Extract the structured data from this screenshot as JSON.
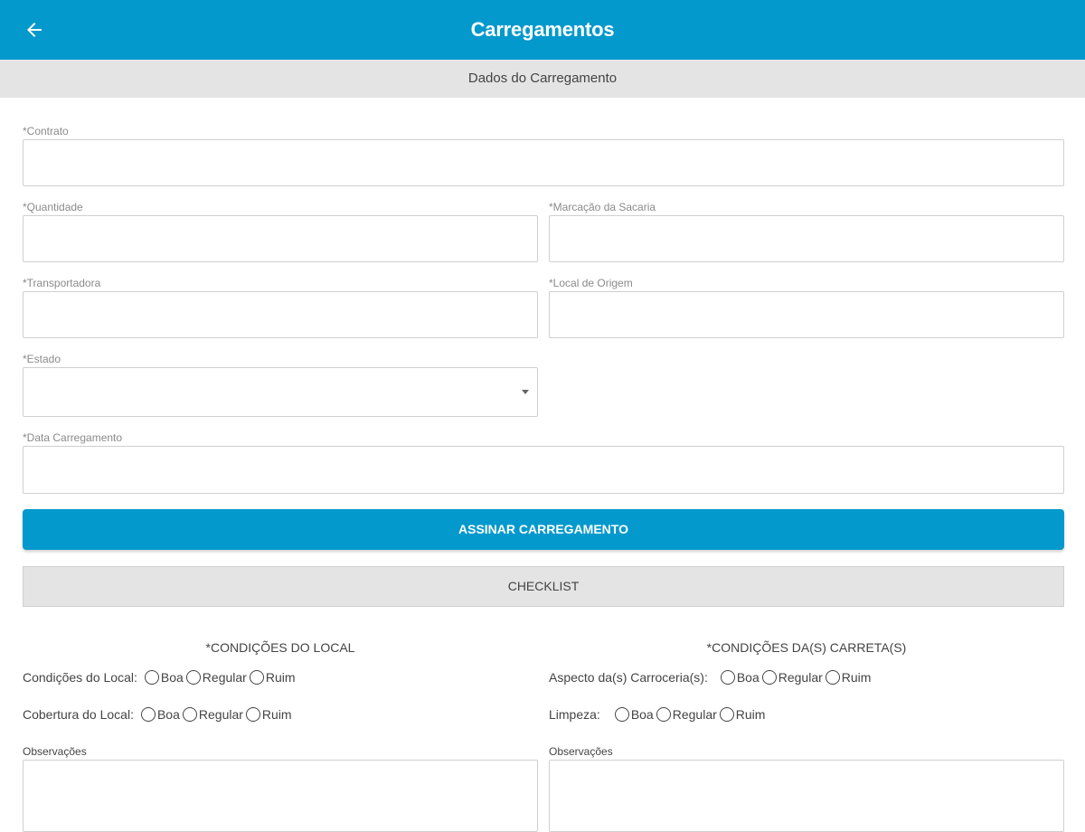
{
  "header": {
    "title": "Carregamentos",
    "section": "Dados do Carregamento"
  },
  "form": {
    "contrato_label": "*Contrato",
    "contrato_value": "",
    "quantidade_label": "*Quantidade",
    "quantidade_value": "",
    "marcacao_label": "*Marcação da Sacaria",
    "marcacao_value": "",
    "transportadora_label": "*Transportadora",
    "transportadora_value": "",
    "local_origem_label": "*Local de Origem",
    "local_origem_value": "",
    "estado_label": "*Estado",
    "estado_value": "",
    "data_label": "*Data Carregamento",
    "data_value": ""
  },
  "buttons": {
    "assinar": "ASSINAR CARREGAMENTO",
    "checklist": "CHECKLIST"
  },
  "checklist": {
    "local": {
      "title": "*CONDIÇÕES DO LOCAL",
      "rows": [
        {
          "label": "Condições do Local:",
          "options": [
            "Boa",
            "Regular",
            "Ruim"
          ]
        },
        {
          "label": "Cobertura do Local:",
          "options": [
            "Boa",
            "Regular",
            "Ruim"
          ]
        }
      ],
      "obs_label": "Observações",
      "obs_value": ""
    },
    "carreta": {
      "title": "*CONDIÇÕES DA(S) CARRETA(S)",
      "rows": [
        {
          "label": "Aspecto da(s) Carroceria(s):",
          "options": [
            "Boa",
            "Regular",
            "Ruim"
          ]
        },
        {
          "label": "Limpeza:",
          "options": [
            "Boa",
            "Regular",
            "Ruim"
          ]
        }
      ],
      "obs_label": "Observações",
      "obs_value": ""
    }
  },
  "icons": {
    "back": "arrow-left-icon",
    "dropdown": "caret-down-icon",
    "radio": "radio-unchecked-icon"
  },
  "colors": {
    "primary": "#0399CC",
    "section_bg": "#E4E4E4",
    "input_border": "#CFCFCF",
    "label": "#8A8A8A"
  }
}
